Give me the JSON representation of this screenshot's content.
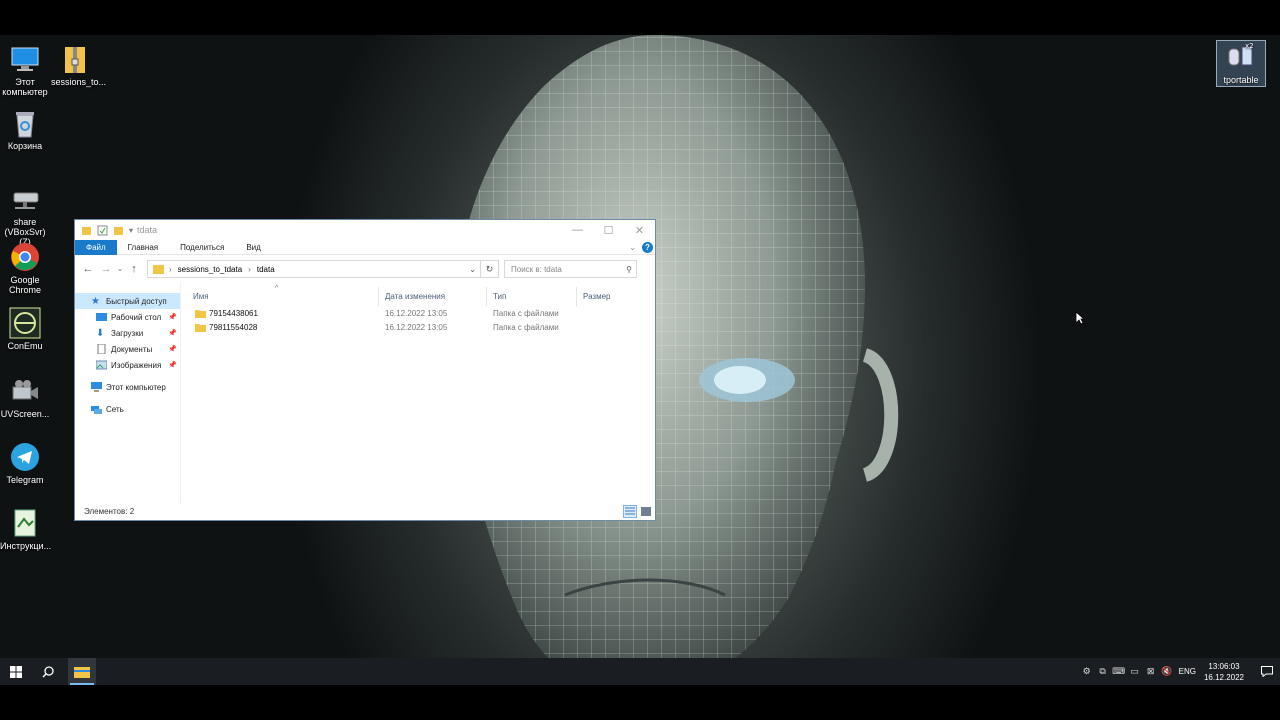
{
  "desktop": {
    "icons": [
      {
        "label": "Этот компьютер",
        "icon": "computer-icon"
      },
      {
        "label": "sessions_to...",
        "icon": "archive-folder-icon"
      },
      {
        "label": "Корзина",
        "icon": "recycle-bin-icon"
      },
      {
        "label": "share (VBoxSvr) (Z)",
        "icon": "network-drive-icon"
      },
      {
        "label": "Google Chrome",
        "icon": "chrome-icon"
      },
      {
        "label": "ConEmu",
        "icon": "conemu-icon"
      },
      {
        "label": "UVScreen...",
        "icon": "camera-icon"
      },
      {
        "label": "Telegram",
        "icon": "telegram-icon"
      },
      {
        "label": "Инструкци...",
        "icon": "document-icon"
      },
      {
        "label": "tportable",
        "icon": "tportable-icon"
      }
    ]
  },
  "explorer": {
    "title": "tdata",
    "ribbon_tabs": [
      "Файл",
      "Главная",
      "Поделиться",
      "Вид"
    ],
    "address": {
      "parent": "sessions_to_tdata",
      "current": "tdata"
    },
    "search_placeholder": "Поиск в: tdata",
    "nav": {
      "quick_access": "Быстрый доступ",
      "desktop": "Рабочий стол",
      "downloads": "Загрузки",
      "documents": "Документы",
      "images": "Изображения",
      "this_pc": "Этот компьютер",
      "network": "Сеть"
    },
    "columns": {
      "name": "Имя",
      "modified": "Дата изменения",
      "type": "Тип",
      "size": "Размер"
    },
    "files": [
      {
        "name": "79154438061",
        "modified": "16.12.2022 13:05",
        "type": "Папка с файлами"
      },
      {
        "name": "79811554028",
        "modified": "16.12.2022 13:05",
        "type": "Папка с файлами"
      }
    ],
    "status": "Элементов: 2"
  },
  "taskbar": {
    "lang": "ENG",
    "time": "13:06:03",
    "date": "16.12.2022"
  },
  "colors": {
    "accent": "#1979ca",
    "taskbar": "#1a1d21",
    "selection": "#cce8ff"
  }
}
